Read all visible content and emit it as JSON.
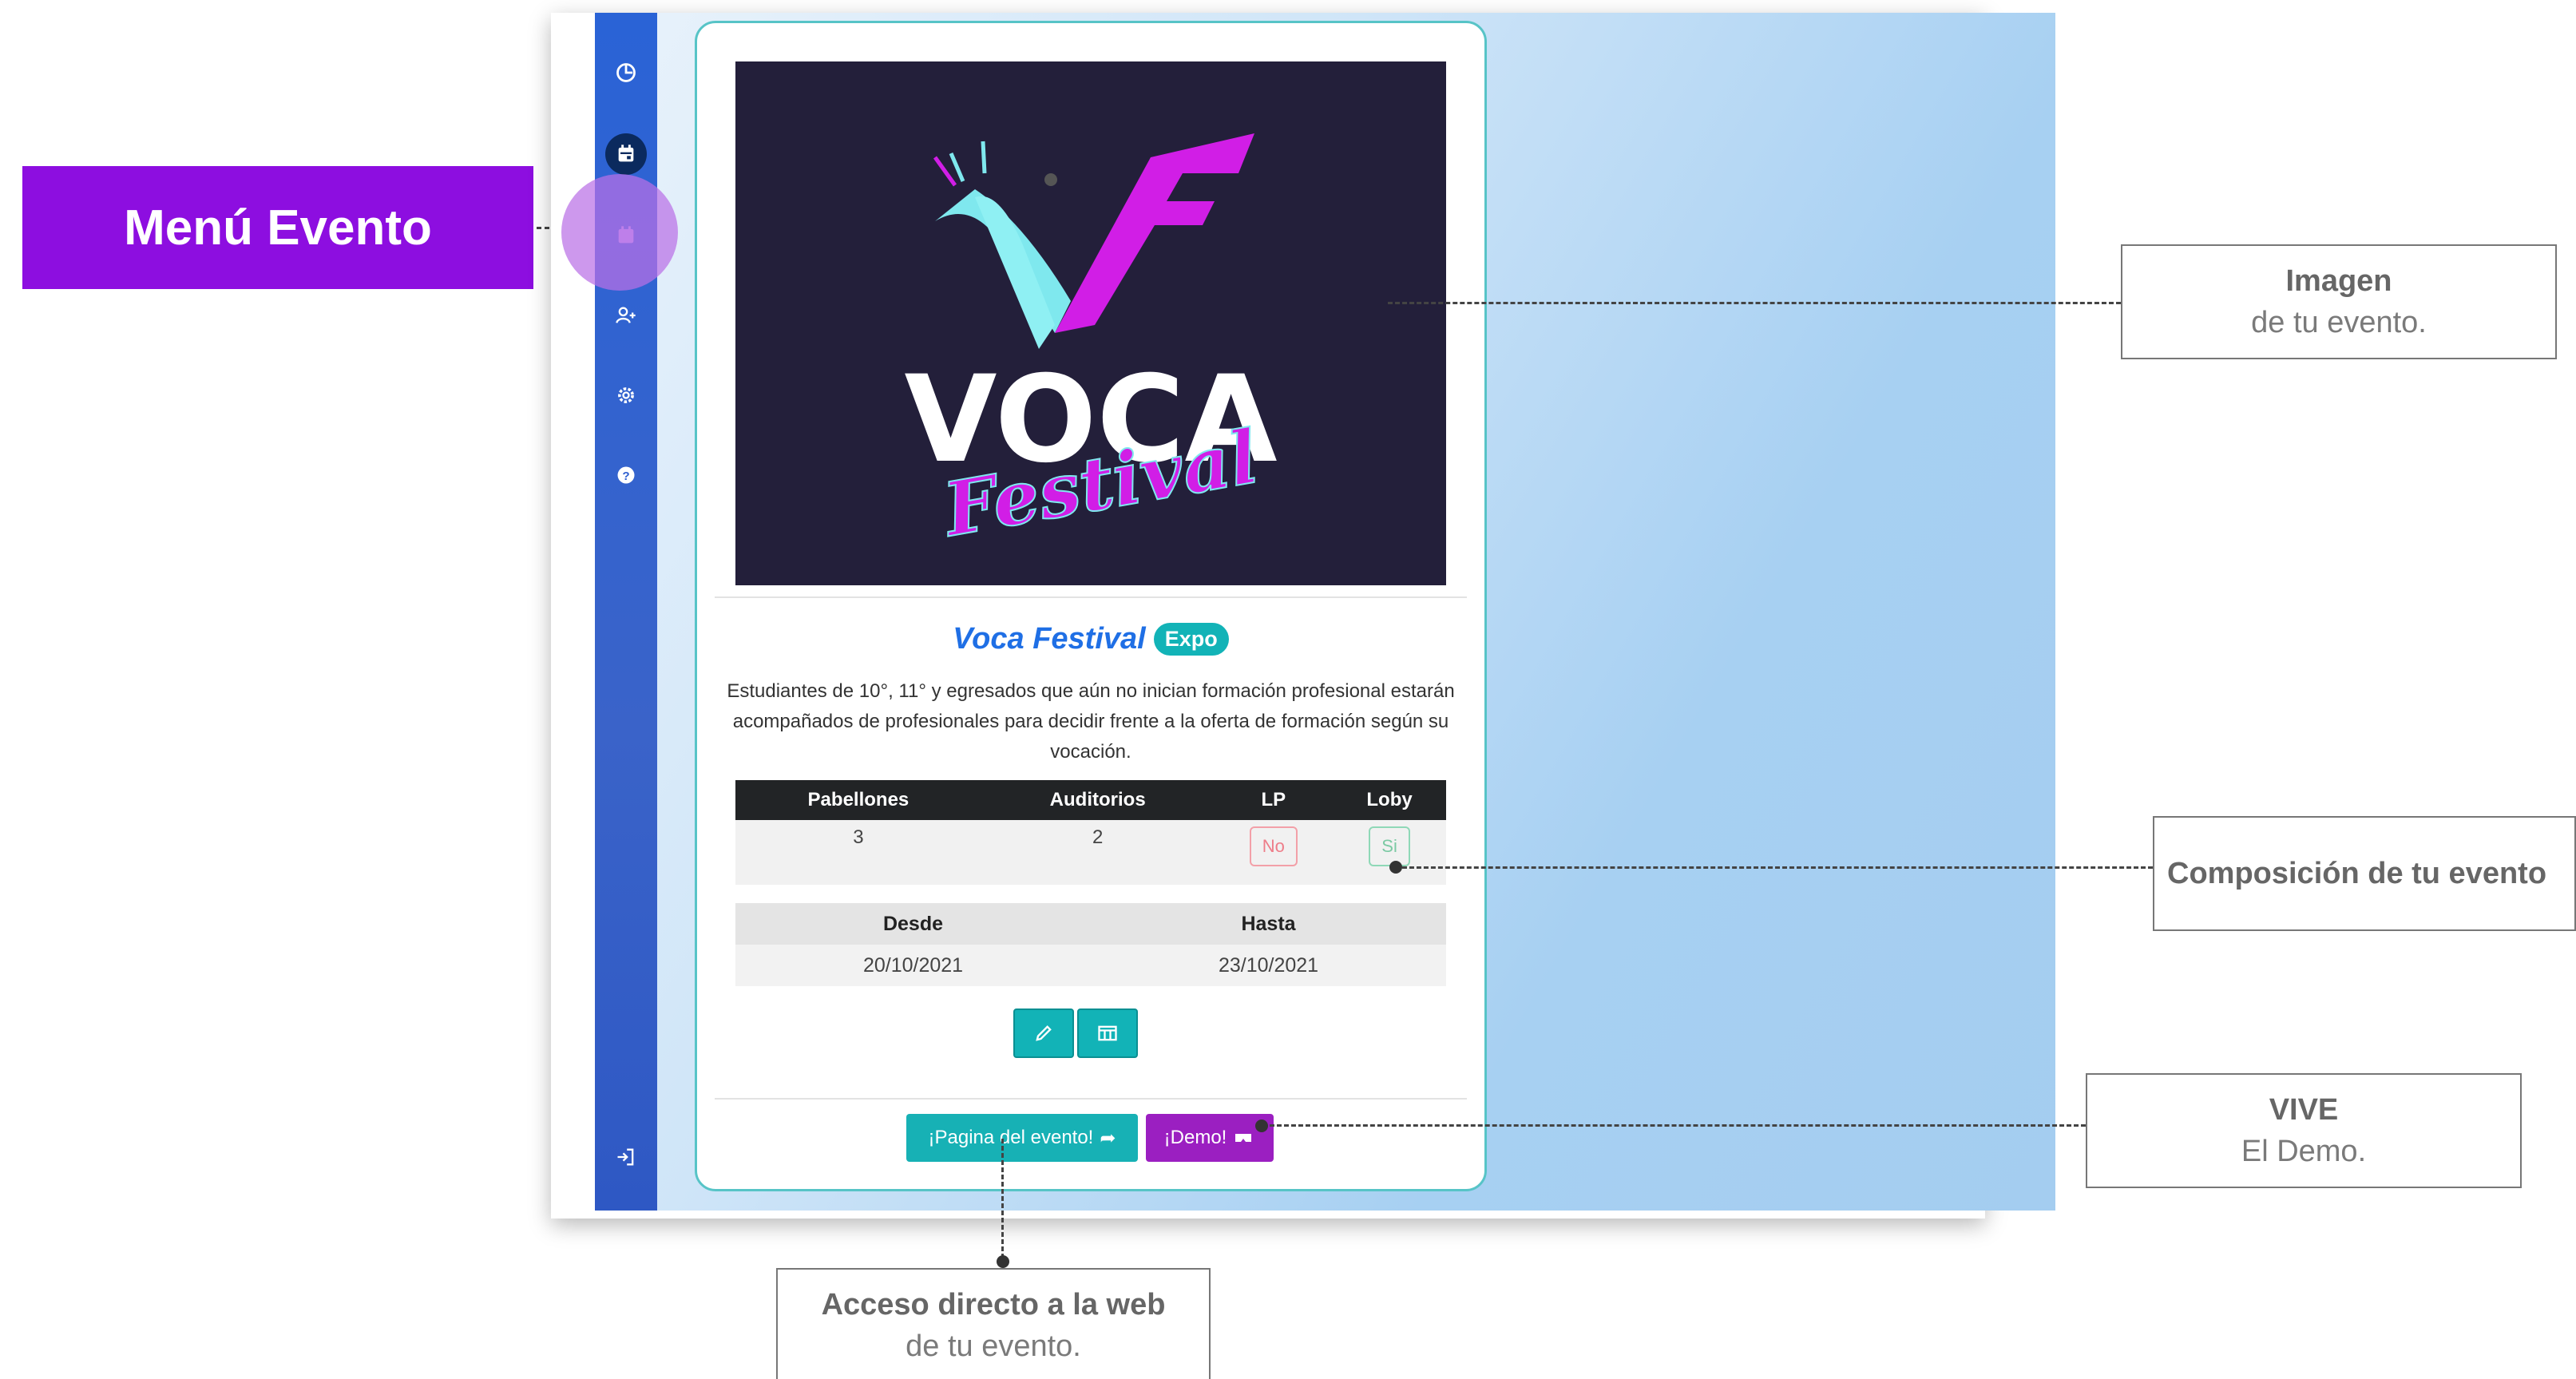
{
  "annotations": {
    "menu_evento": "Menú Evento",
    "imagen_title": "Imagen",
    "imagen_sub": "de tu evento.",
    "composicion": "Composición de tu evento",
    "vive_title": "VIVE",
    "vive_sub": "El Demo.",
    "acceso_title": "Acceso directo a la web",
    "acceso_sub": "de tu evento."
  },
  "sidebar": {
    "items": [
      {
        "icon": "dashboard-icon",
        "active": false
      },
      {
        "icon": "calendar-event-icon",
        "active": true
      },
      {
        "icon": "calendar-icon",
        "active": false
      },
      {
        "icon": "add-user-icon",
        "active": false
      },
      {
        "icon": "gear-icon",
        "active": false
      },
      {
        "icon": "help-icon",
        "active": false
      },
      {
        "icon": "logout-icon",
        "active": false
      }
    ]
  },
  "event": {
    "image_logo_text": "VOCA",
    "image_logo_script": "Festival",
    "title": "Voca Festival",
    "badge": "Expo",
    "description": "Estudiantes de 10°, 11° y egresados que aún no inician formación profesional estarán acompañados de profesionales para decidir frente a la oferta de formación según su vocación.",
    "composition": {
      "headers": [
        "Pabellones",
        "Auditorios",
        "LP",
        "Loby"
      ],
      "pabellones": "3",
      "auditorios": "2",
      "lp": "No",
      "loby": "Si"
    },
    "dates": {
      "headers": [
        "Desde",
        "Hasta"
      ],
      "desde": "20/10/2021",
      "hasta": "23/10/2021"
    },
    "buttons": {
      "page_link": "¡Pagina del evento!",
      "demo": "¡Demo!"
    }
  },
  "colors": {
    "accent_purple": "#8d0ee0",
    "teal": "#12b3b7",
    "sidebar_blue": "#2e5fd0",
    "title_blue": "#1f6fe5"
  }
}
